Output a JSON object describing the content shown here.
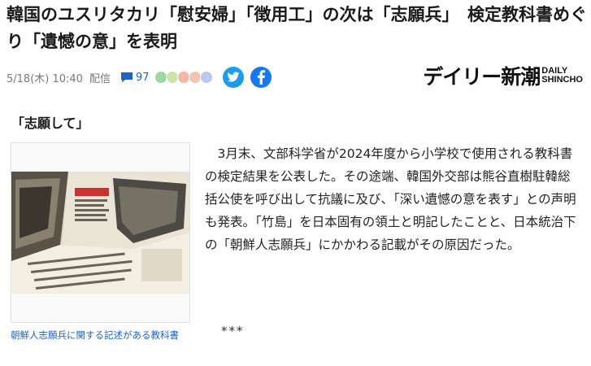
{
  "article": {
    "title": "韓国のユスリタカリ「慰安婦」「徴用工」の次は「志願兵」　検定教科書めぐり「遺憾の意」を表明",
    "date": "5/18(木) 10:40",
    "delivery": "配信",
    "comment_count": "97",
    "publisher_logo": {
      "main": "デイリー新潮",
      "side_top": "DAILY",
      "side_bottom": "SHINCHO"
    },
    "section_heading": "「志願して」",
    "image_caption": "朝鮮人志願兵に関する記述がある教科書",
    "body": "3月末、文部科学省が2024年度から小学校で使用される教科書の検定結果を公表した。その途端、韓国外交部は熊谷直樹駐韓総括公使を呼び出して抗議に及び、「深い遺憾の意を表す」との声明も発表。「竹島」を日本固有の領土と明記したことと、日本統治下の「朝鮮人志願兵」にかかわる記載がその原因だった。",
    "separator": "***"
  },
  "icons": {
    "comment": "comment-bubble-icon",
    "reactions": "reaction-faces-icon",
    "twitter": "twitter-icon",
    "facebook": "facebook-icon"
  },
  "colors": {
    "link": "#1d63c9",
    "twitter": "#1d9bf0",
    "facebook": "#1877f2"
  }
}
